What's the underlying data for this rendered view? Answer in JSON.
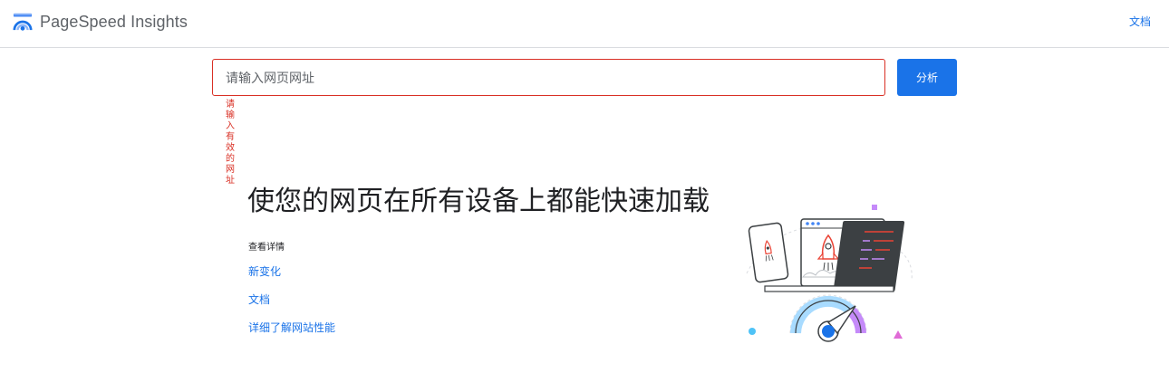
{
  "header": {
    "brand_name": "PageSpeed Insights",
    "docs_link": "文档"
  },
  "search": {
    "placeholder": "请输入网页网址",
    "value": "",
    "analyze_label": "分析",
    "error_text": "请输入有效的网址"
  },
  "hero": {
    "title": "使您的网页在所有设备上都能快速加载",
    "learn_more_heading": "查看详情",
    "links": [
      {
        "label": "新变化"
      },
      {
        "label": "文档"
      },
      {
        "label": "详细了解网站性能"
      }
    ]
  },
  "icons": {
    "logo": "pagespeed-logo-icon",
    "illustration": "rocket-speed-gauge-illustration"
  },
  "colors": {
    "accent": "#1a73e8",
    "error": "#d93025",
    "title_text": "#202124",
    "muted_text": "#5f6368",
    "border": "#dadce0",
    "illustration_dark": "#3c4043",
    "illustration_purple": "#c5a3ff",
    "illustration_light_blue": "#a8dbff"
  }
}
